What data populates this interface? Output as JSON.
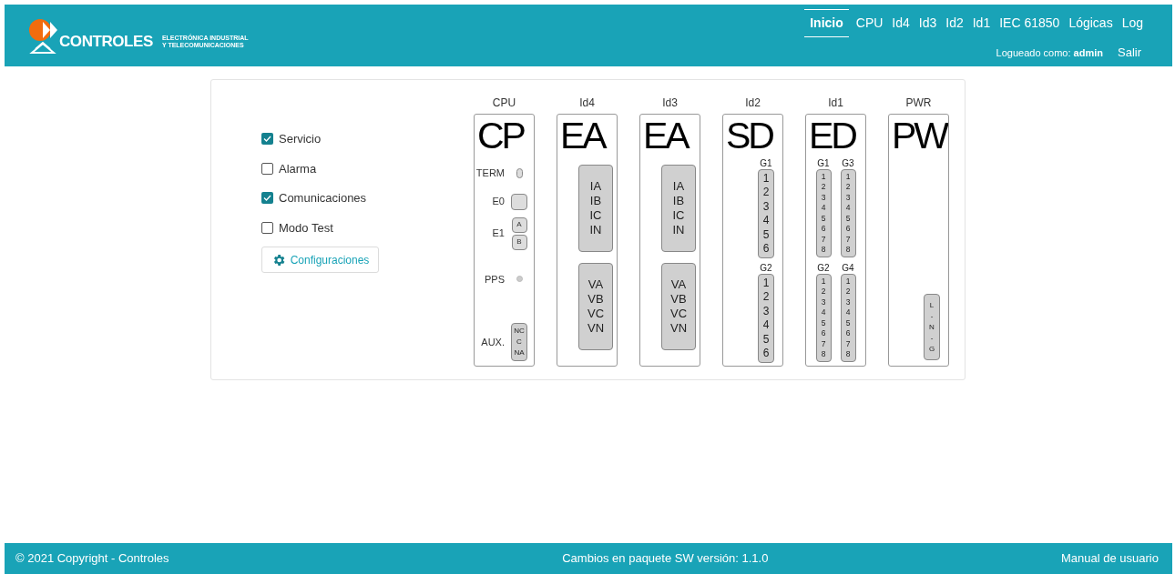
{
  "header": {
    "logo_name": "CONTROLES",
    "tagline": [
      "ELECTRÓNICA INDUSTRIAL",
      "Y TELECOMUNICACIONES"
    ],
    "nav": [
      {
        "label": "Inicio",
        "selected": true
      },
      {
        "label": "CPU",
        "selected": false
      },
      {
        "label": "Id4",
        "selected": false
      },
      {
        "label": "Id3",
        "selected": false
      },
      {
        "label": "Id2",
        "selected": false
      },
      {
        "label": "Id1",
        "selected": false
      },
      {
        "label": "IEC 61850",
        "selected": false
      },
      {
        "label": "Lógicas",
        "selected": false
      },
      {
        "label": "Log",
        "selected": false
      }
    ],
    "login_label": "Logueado como:",
    "user": "admin",
    "logout": "Salir"
  },
  "checks": [
    {
      "label": "Servicio",
      "checked": true
    },
    {
      "label": "Alarma",
      "checked": false
    },
    {
      "label": "Comunicaciones",
      "checked": true
    },
    {
      "label": "Modo Test",
      "checked": false
    }
  ],
  "config_button": "Configuraciones",
  "modules": [
    {
      "title": "CPU",
      "code": "CP",
      "kind": "cpu",
      "rows": [
        {
          "label": "TERM",
          "kind": "oval"
        },
        {
          "label": "E0",
          "kind": "port"
        },
        {
          "label": "E1",
          "kind": "ports",
          "terms": [
            "A",
            "B"
          ]
        },
        {
          "label": "PPS",
          "kind": "led"
        },
        {
          "label": "AUX.",
          "kind": "terminal",
          "terms": [
            "NC",
            "C",
            "NA"
          ]
        }
      ]
    },
    {
      "title": "Id4",
      "code": "EA",
      "kind": "analog",
      "blocks": [
        [
          "IA",
          "IB",
          "IC",
          "IN"
        ],
        [
          "VA",
          "VB",
          "VC",
          "VN"
        ]
      ]
    },
    {
      "title": "Id3",
      "code": "EA",
      "kind": "analog",
      "blocks": [
        [
          "IA",
          "IB",
          "IC",
          "IN"
        ],
        [
          "VA",
          "VB",
          "VC",
          "VN"
        ]
      ]
    },
    {
      "title": "Id2",
      "code": "SD",
      "kind": "outputs",
      "groups": [
        {
          "label": "G1",
          "terms": [
            "1",
            "2",
            "3",
            "4",
            "5",
            "6"
          ]
        },
        {
          "label": "G2",
          "terms": [
            "1",
            "2",
            "3",
            "4",
            "5",
            "6"
          ]
        }
      ]
    },
    {
      "title": "Id1",
      "code": "ED",
      "kind": "inputs",
      "groups": [
        {
          "label": "G1",
          "terms": [
            "1",
            "2",
            "3",
            "4",
            "5",
            "6",
            "7",
            "8"
          ]
        },
        {
          "label": "G3",
          "terms": [
            "1",
            "2",
            "3",
            "4",
            "5",
            "6",
            "7",
            "8"
          ]
        },
        {
          "label": "G2",
          "terms": [
            "1",
            "2",
            "3",
            "4",
            "5",
            "6",
            "7",
            "8"
          ]
        },
        {
          "label": "G4",
          "terms": [
            "1",
            "2",
            "3",
            "4",
            "5",
            "6",
            "7",
            "8"
          ]
        }
      ]
    },
    {
      "title": "PWR",
      "code": "PW",
      "kind": "power",
      "terms": [
        "L",
        "-",
        "N",
        "-",
        "G"
      ]
    }
  ],
  "footer": {
    "copyright": "© 2021 Copyright - Controles",
    "version": "Cambios en paquete SW versión: 1.1.0",
    "manual": "Manual de usuario"
  }
}
